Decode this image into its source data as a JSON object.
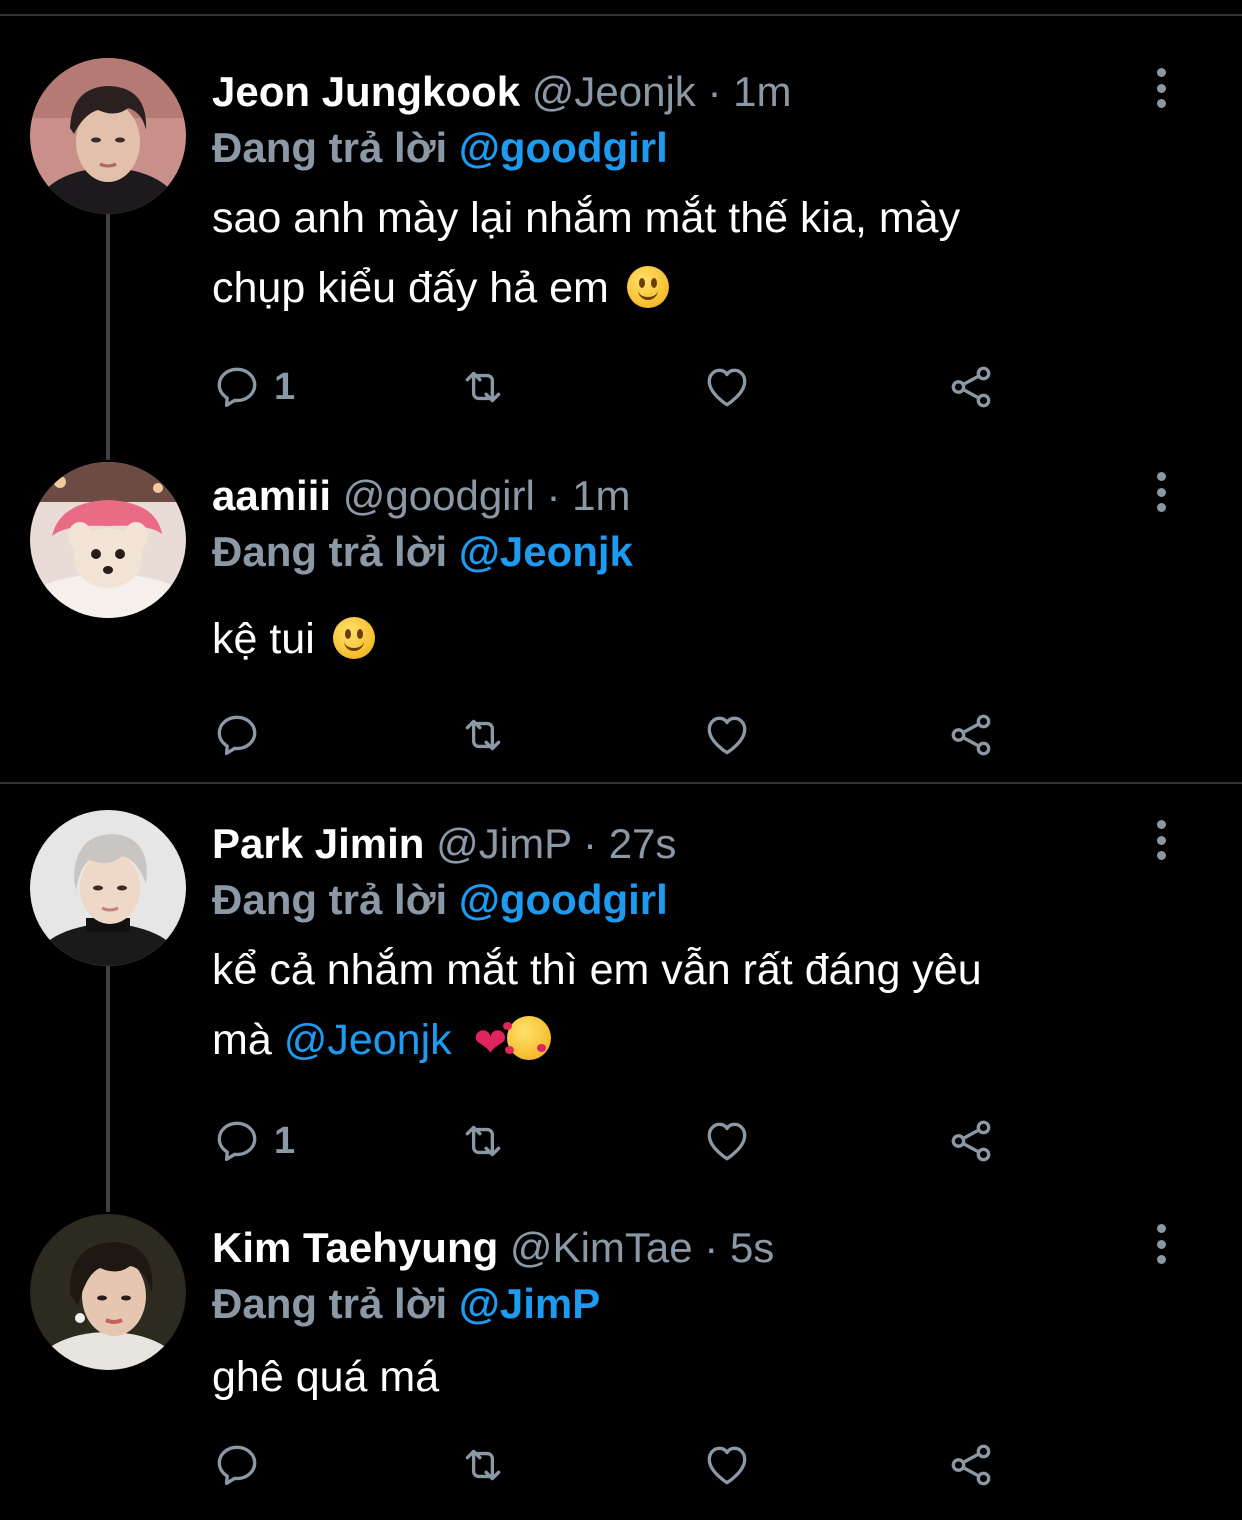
{
  "tweets": [
    {
      "name": "Jeon Jungkook",
      "handle": "@Jeonjk",
      "sep": "·",
      "time": "1m",
      "replying_prefix": "Đang trả lời",
      "replying_to": "@goodgirl",
      "body_line1": "sao anh mày lại nhắm mắt thế kia, mày",
      "body_line2": "chụp kiểu đấy hả em",
      "reply_count": "1",
      "avatar": "avatar-jungkook"
    },
    {
      "name": "aamiii",
      "handle": "@goodgirl",
      "sep": "·",
      "time": "1m",
      "replying_prefix": "Đang trả lời",
      "replying_to": "@Jeonjk",
      "body_line1": "kệ tui",
      "reply_count": "",
      "avatar": "avatar-dog"
    },
    {
      "name": "Park Jimin",
      "handle": "@JimP",
      "sep": "·",
      "time": "27s",
      "replying_prefix": "Đang trả lời",
      "replying_to": "@goodgirl",
      "body_line1": "kể cả nhắm mắt thì em vẫn rất đáng yêu",
      "body_line2_prefix": "mà",
      "body_line2_mention": "@Jeonjk",
      "reply_count": "1",
      "avatar": "avatar-jimin"
    },
    {
      "name": "Kim Taehyung",
      "handle": "@KimTae",
      "sep": "·",
      "time": "5s",
      "replying_prefix": "Đang trả lời",
      "replying_to": "@JimP",
      "body_line1": "ghê quá má",
      "reply_count": "",
      "avatar": "avatar-taehyung"
    }
  ],
  "icons": {
    "reply": "reply-icon",
    "retweet": "retweet-icon",
    "like": "heart-icon",
    "share": "share-icon",
    "more": "more-options-icon"
  },
  "colors": {
    "background": "#000000",
    "secondary_text": "#8b98a5",
    "mention": "#1d9bf0",
    "divider": "#2f3336"
  }
}
